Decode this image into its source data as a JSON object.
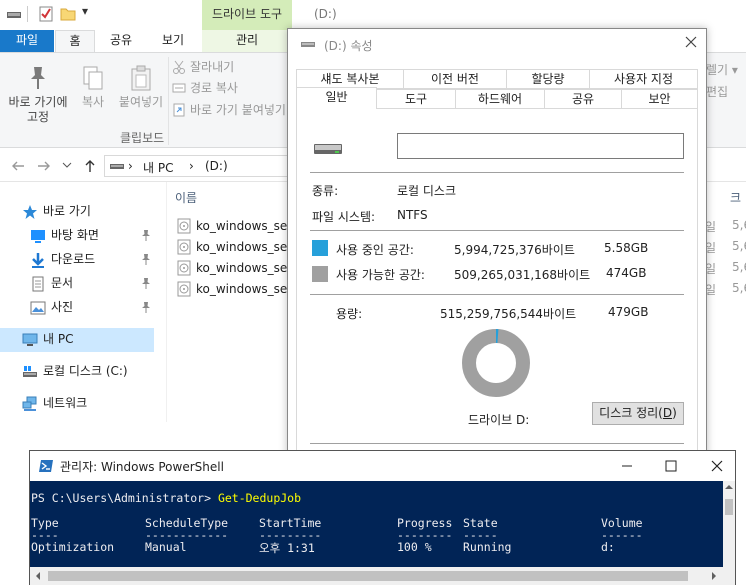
{
  "explorer": {
    "context_tab_group": "드라이브 도구",
    "title_path": "(D:)",
    "ribbon_tabs": {
      "file": "파일",
      "home": "홈",
      "share": "공유",
      "view": "보기",
      "manage": "관리"
    },
    "ribbon": {
      "pin_label_1": "바로 가기에",
      "pin_label_2": "고정",
      "copy": "복사",
      "paste": "붙여넣기",
      "cut": "잘라내기",
      "copy_path": "경로 복사",
      "paste_shortcut": "바로 가기 붙여넣기",
      "group_clipboard": "클립보드",
      "right_top": "렐기 ▾",
      "right_mid": "편집"
    },
    "address": {
      "this_pc": "내 PC",
      "drive": "(D:)"
    },
    "nav": {
      "quick_access": "바로 가기",
      "desktop": "바탕 화면",
      "downloads": "다운로드",
      "documents": "문서",
      "pictures": "사진",
      "this_pc": "내 PC",
      "local_disk": "로컬 디스크 (C:)",
      "network": "네트워크"
    },
    "file_list": {
      "col_name": "이름",
      "col_right": "크",
      "files": [
        "ko_windows_serv",
        "ko_windows_serv",
        "ko_windows_serv",
        "ko_windows_serv"
      ],
      "right_col_a": [
        "일",
        "일",
        "일",
        "일"
      ],
      "right_col_b": [
        "5,6",
        "5,6",
        "5,6",
        "5,6"
      ]
    }
  },
  "properties": {
    "title": "(D:) 속성",
    "tabs_row1": [
      "섀도 복사본",
      "이전 버전",
      "할당량",
      "사용자 지정"
    ],
    "tabs_row2": [
      "일반",
      "도구",
      "하드웨어",
      "공유",
      "보안"
    ],
    "name_value": "",
    "type_label": "종류:",
    "type_value": "로컬 디스크",
    "fs_label": "파일 시스템:",
    "fs_value": "NTFS",
    "used_label": "사용 중인 공간:",
    "used_bytes": "5,994,725,376바이트",
    "used_gb": "5.58GB",
    "free_label": "사용 가능한 공간:",
    "free_bytes": "509,265,031,168바이트",
    "free_gb": "474GB",
    "cap_label": "용량:",
    "cap_bytes": "515,259,756,544바이트",
    "cap_gb": "479GB",
    "drive_label": "드라이브 D:",
    "cleanup_text": "디스크 정리(",
    "cleanup_key": "D",
    "cleanup_end": ")",
    "used_fraction": 0.0116,
    "colors": {
      "used": "#26a0da",
      "free": "#a0a0a0"
    }
  },
  "powershell": {
    "title": "관리자: Windows PowerShell",
    "prompt": "PS C:\\Users\\Administrator> ",
    "command": "Get-DedupJob",
    "headers": [
      "Type",
      "ScheduleType",
      "StartTime",
      "Progress",
      "State",
      "Volume"
    ],
    "dashes": [
      "----",
      "------------",
      "---------",
      "--------",
      "-----",
      "------"
    ],
    "row": [
      "Optimization",
      "Manual",
      "오후 1:31",
      "100 %",
      "Running",
      "d:"
    ]
  }
}
